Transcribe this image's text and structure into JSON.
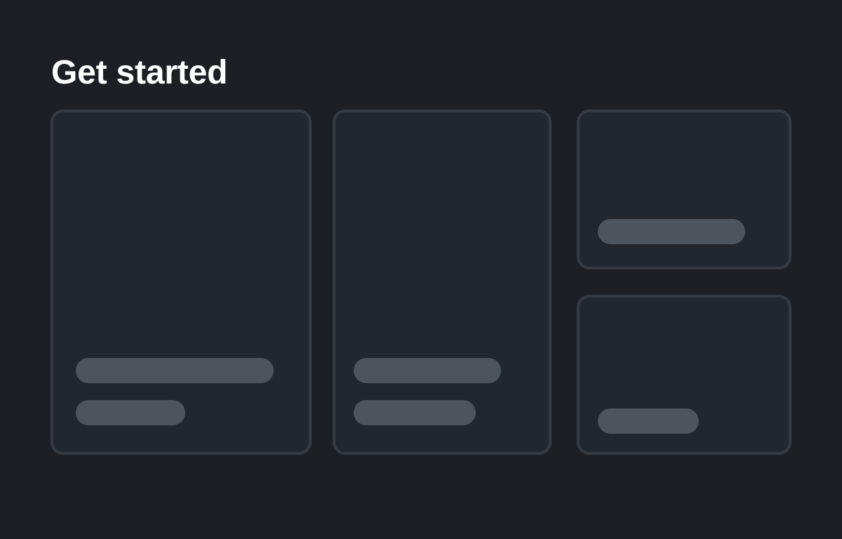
{
  "page": {
    "title": "Get started"
  },
  "colors": {
    "background": "#1d1f25",
    "card_fill": "#22262e",
    "card_border": "#353a43",
    "placeholder_bar": "#4e545d",
    "title_text": "#ffffff"
  },
  "cards": [
    {
      "placeholder_lines": 2,
      "state": "loading-skeleton"
    },
    {
      "placeholder_lines": 2,
      "state": "loading-skeleton"
    },
    {
      "placeholder_lines": 1,
      "state": "loading-skeleton"
    },
    {
      "placeholder_lines": 1,
      "state": "loading-skeleton"
    }
  ]
}
